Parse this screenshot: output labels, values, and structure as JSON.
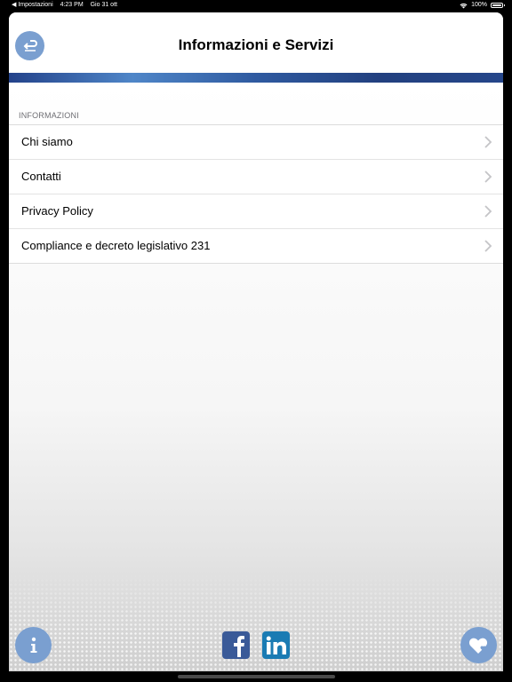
{
  "status_bar": {
    "back_app": "◀ Impostazioni",
    "time": "4:23 PM",
    "date": "Gio 31 ott",
    "battery": "100%"
  },
  "nav": {
    "title": "Informazioni e Servizi"
  },
  "section": {
    "header": "INFORMAZIONI"
  },
  "menu": {
    "items": [
      {
        "label": "Chi siamo"
      },
      {
        "label": "Contatti"
      },
      {
        "label": "Privacy Policy"
      },
      {
        "label": "Compliance e decreto legislativo 231"
      }
    ]
  },
  "colors": {
    "accent": "#7a9fd0",
    "band_dark": "#23428a",
    "facebook": "#3a5a98",
    "linkedin": "#1a7bb3"
  },
  "icons": [
    "back-icon",
    "chevron-right-icon",
    "info-icon",
    "facebook-icon",
    "linkedin-icon",
    "heart-icon"
  ]
}
